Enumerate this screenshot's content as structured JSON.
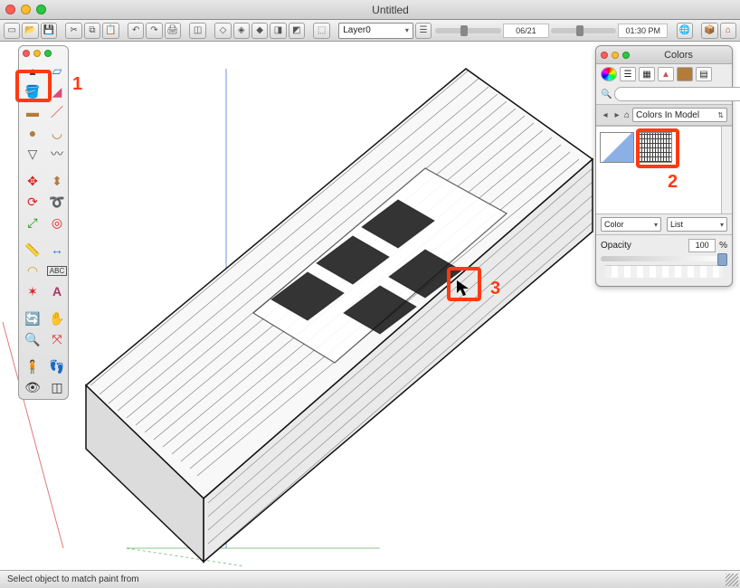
{
  "window": {
    "title": "Untitled"
  },
  "toolbar": {
    "layer_label": "Layer0",
    "date": "06/21",
    "time": "01:30 PM"
  },
  "tools": {
    "select": "Select",
    "lasso": "Lasso",
    "paint_bucket": "Paint Bucket",
    "eraser": "Eraser",
    "rectangle": "Rectangle",
    "line": "Line",
    "circle": "Circle",
    "arc": "Arc",
    "polygon": "Polygon",
    "freehand": "Freehand",
    "move": "Move",
    "push_pull": "Push/Pull",
    "rotate": "Rotate",
    "follow_me": "Follow Me",
    "scale": "Scale",
    "offset": "Offset",
    "tape": "Tape Measure",
    "dimension": "Dimension",
    "protractor": "Protractor",
    "text": "Text",
    "axes": "Axes",
    "d3text": "3D Text",
    "orbit": "Orbit",
    "pan": "Pan",
    "zoom": "Zoom",
    "zoom_extents": "Zoom Extents",
    "position_camera": "Position Camera",
    "walk": "Walk",
    "look": "Look Around",
    "section": "Section Plane"
  },
  "colors": {
    "title": "Colors",
    "library": "Colors In Model",
    "color_drop": "Color",
    "list_drop": "List",
    "opacity_label": "Opacity",
    "opacity_value": "100",
    "opacity_unit": "%",
    "search_placeholder": ""
  },
  "annotations": {
    "n1": "1",
    "n2": "2",
    "n3": "3"
  },
  "status": {
    "message": "Select object to match paint from"
  }
}
